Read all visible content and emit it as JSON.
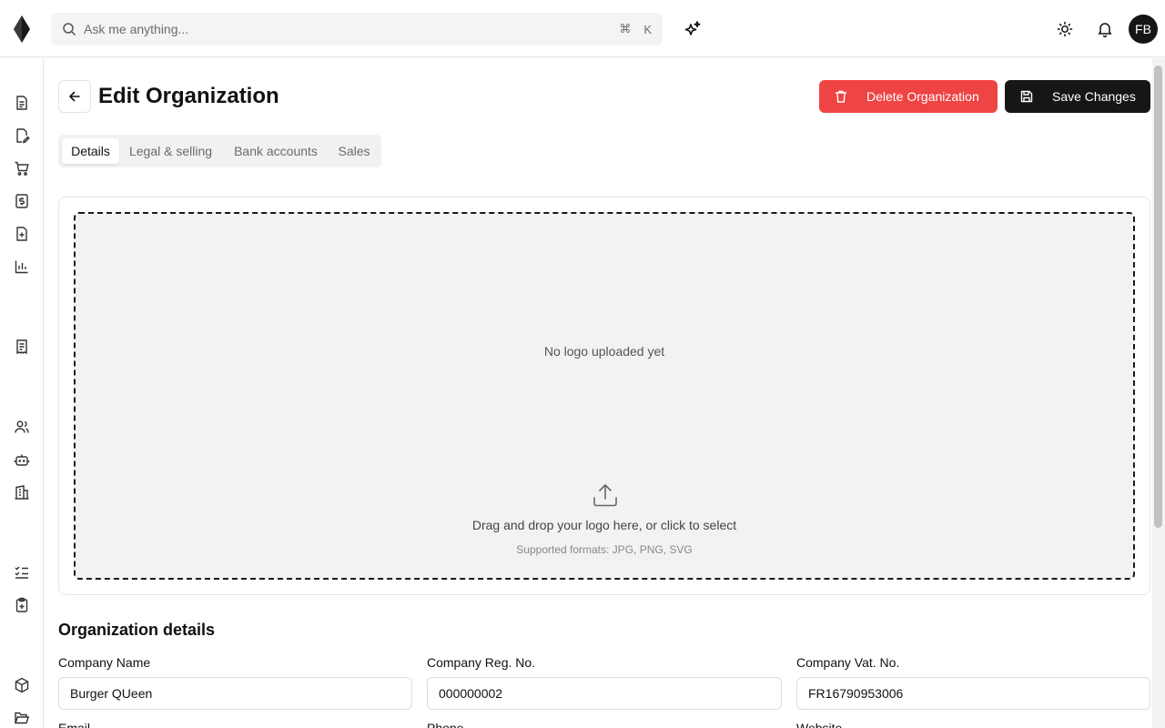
{
  "search": {
    "placeholder": "Ask me anything...",
    "shortcut_symbol": "⌘",
    "shortcut_key": "K"
  },
  "user": {
    "initials": "FB"
  },
  "sidebar": {
    "items": [
      {
        "icon": "file-text-icon"
      },
      {
        "icon": "file-signature-icon"
      },
      {
        "icon": "shopping-cart-icon"
      },
      {
        "icon": "dollar-receipt-icon"
      },
      {
        "icon": "file-plus-icon"
      },
      {
        "icon": "bar-chart-icon"
      },
      {
        "icon": "receipt-icon"
      },
      {
        "icon": "users-icon"
      },
      {
        "icon": "bot-icon"
      },
      {
        "icon": "building-icon"
      },
      {
        "icon": "list-checks-icon"
      },
      {
        "icon": "clipboard-plus-icon"
      },
      {
        "icon": "package-icon"
      },
      {
        "icon": "folder-open-icon"
      }
    ]
  },
  "header": {
    "title": "Edit Organization",
    "delete_label": "Delete Organization",
    "save_label": "Save Changes"
  },
  "tabs": [
    {
      "label": "Details",
      "active": true
    },
    {
      "label": "Legal & selling",
      "active": false
    },
    {
      "label": "Bank accounts",
      "active": false
    },
    {
      "label": "Sales",
      "active": false
    }
  ],
  "logo_upload": {
    "empty_text": "No logo uploaded yet",
    "instruction": "Drag and drop your logo here, or click to select",
    "formats": "Supported formats: JPG, PNG, SVG"
  },
  "form": {
    "section_title": "Organization details",
    "fields": [
      {
        "label": "Company Name",
        "value": "Burger QUeen"
      },
      {
        "label": "Company Reg. No.",
        "value": "000000002"
      },
      {
        "label": "Company Vat. No.",
        "value": "FR16790953006"
      }
    ],
    "next_labels": [
      "Email",
      "Phone",
      "Website"
    ]
  },
  "colors": {
    "danger": "#ef4444",
    "primary": "#161616"
  }
}
